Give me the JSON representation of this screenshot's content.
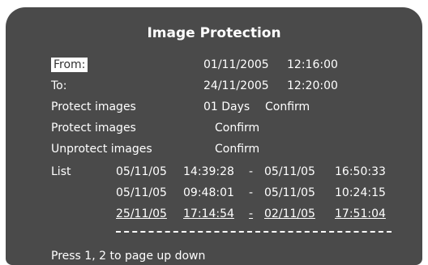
{
  "title": "Image Protection",
  "from": {
    "label": "From:",
    "date": "01/11/2005",
    "time": "12:16:00"
  },
  "to": {
    "label": "To:",
    "date": "24/11/2005",
    "time": "12:20:00"
  },
  "protect_days": {
    "label": "Protect images",
    "value": "01 Days",
    "confirm": "Confirm"
  },
  "protect": {
    "label": "Protect images",
    "confirm": "Confirm"
  },
  "unprotect": {
    "label": "Unprotect images",
    "confirm": "Confirm"
  },
  "list": {
    "label": "List",
    "rows": [
      {
        "d1": "05/11/05",
        "t1": "14:39:28",
        "sep": "-",
        "d2": "05/11/05",
        "t2": "16:50:33"
      },
      {
        "d1": "05/11/05",
        "t1": "09:48:01",
        "sep": "-",
        "d2": "05/11/05",
        "t2": "10:24:15"
      },
      {
        "d1": "25/11/05",
        "t1": "17:14:54",
        "sep": "-",
        "d2": "02/11/05",
        "t2": "17:51:04"
      }
    ]
  },
  "footer": "Press 1, 2 to page up down"
}
